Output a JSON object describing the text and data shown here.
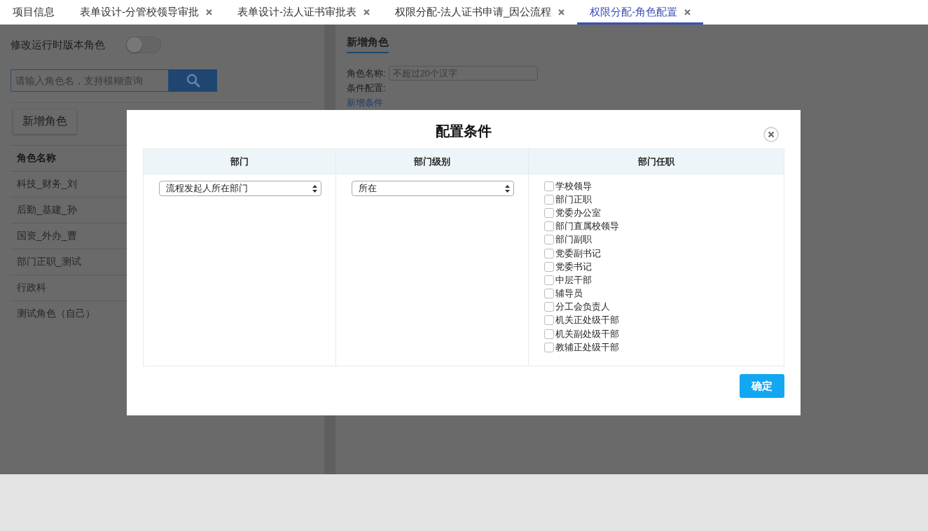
{
  "tabs": [
    {
      "label": "项目信息",
      "selected": false,
      "closable": false
    },
    {
      "label": "表单设计-分管校领导审批",
      "selected": false,
      "closable": true
    },
    {
      "label": "表单设计-法人证书审批表",
      "selected": false,
      "closable": true
    },
    {
      "label": "权限分配-法人证书申请_因公流程",
      "selected": false,
      "closable": true
    },
    {
      "label": "权限分配-角色配置",
      "selected": true,
      "closable": true
    }
  ],
  "sidebar": {
    "toggle": {
      "label": "修改运行时版本角色",
      "on": false
    },
    "search": {
      "placeholder": "请输入角色名，支持模糊查询"
    },
    "add_button": "新增角色",
    "table": {
      "columns": [
        "角色名称"
      ],
      "rows": [
        "科技_财务_刘",
        "后勤_基建_孙",
        "国资_外办_曹",
        "部门正职_测试",
        "行政科",
        "测试角色（自己）"
      ]
    }
  },
  "form": {
    "title": "新增角色",
    "name_label": "角色名称:",
    "name_placeholder": "不超过20个汉字",
    "condition_label": "条件配置:",
    "add_condition_link": "新增条件"
  },
  "dialog": {
    "title": "配置条件",
    "columns": [
      "部门",
      "部门级别",
      "部门任职"
    ],
    "department_select": "流程发起人所在部门",
    "level_select": "所在",
    "positions": [
      {
        "label": "学校领导",
        "checked": false
      },
      {
        "label": "部门正职",
        "checked": false
      },
      {
        "label": "党委办公室",
        "checked": false
      },
      {
        "label": "部门直属校领导",
        "checked": false
      },
      {
        "label": "部门副职",
        "checked": false
      },
      {
        "label": "党委副书记",
        "checked": false
      },
      {
        "label": "党委书记",
        "checked": false
      },
      {
        "label": "中层干部",
        "checked": false
      },
      {
        "label": "辅导员",
        "checked": false
      },
      {
        "label": "分工会负责人",
        "checked": false
      },
      {
        "label": "机关正处级干部",
        "checked": false
      },
      {
        "label": "机关副处级干部",
        "checked": false
      },
      {
        "label": "教辅正处级干部",
        "checked": false
      }
    ],
    "confirm_button": "确定"
  }
}
